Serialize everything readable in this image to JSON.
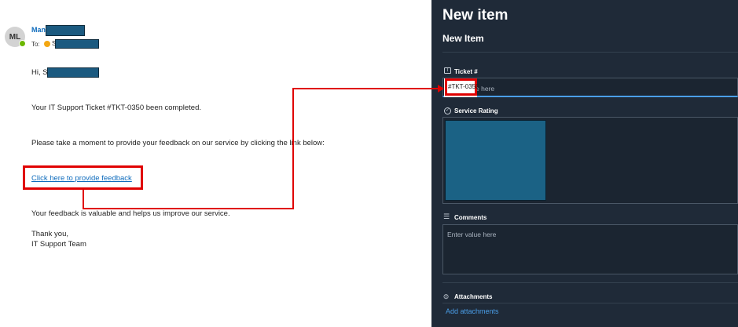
{
  "email": {
    "avatar_initials": "ML",
    "sender_name": "Man",
    "to_label": "To:",
    "to_name_partial": "S",
    "greeting": "Hi, S",
    "line1": "Your IT Support Ticket #TKT-0350 been completed.",
    "line2": "Please take a moment to provide your feedback on our service by clicking the link below:",
    "feedback_link": "Click here to provide feedback",
    "line3": "Your feedback is valuable and helps us improve our service.",
    "signoff": "Thank you,",
    "signature": "IT Support Team"
  },
  "form": {
    "title": "New item",
    "subtitle": "New Item",
    "ticket": {
      "label": "Ticket #",
      "value": "#TKT-0350",
      "placeholder_tail": "e here"
    },
    "service_rating": {
      "label": "Service Rating"
    },
    "comments": {
      "label": "Comments",
      "placeholder": "Enter value here"
    },
    "attachments": {
      "label": "Attachments",
      "link": "Add attachments"
    }
  },
  "colors": {
    "link": "#0f6cbd",
    "highlight": "#e00000",
    "panel_bg": "#1f2a38",
    "accent": "#4a9ee8",
    "redaction": "#1b5a80"
  },
  "icons": [
    "presence-available-icon",
    "clock-icon",
    "text-field-icon",
    "check-circle-icon",
    "lines-icon",
    "paperclip-icon"
  ]
}
